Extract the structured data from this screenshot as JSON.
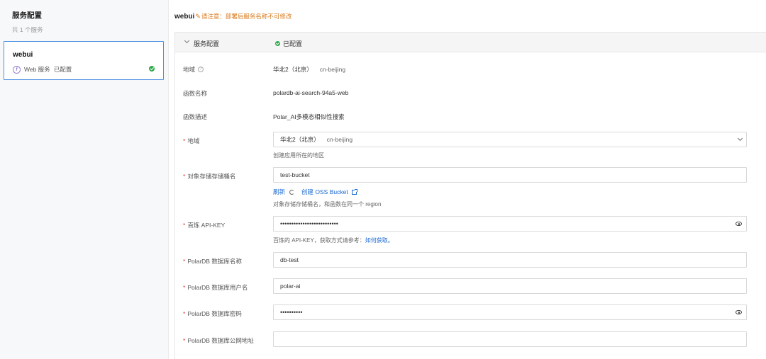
{
  "sidebar": {
    "title": "服务配置",
    "count": "共 1 个服务",
    "service": {
      "name": "webui",
      "type": "Web 服务",
      "status": "已配置"
    }
  },
  "header": {
    "service_name": "webui",
    "edit_icon": "pencil-icon",
    "warning": "请注意：部署后服务名称不可修改"
  },
  "panel": {
    "title": "服务配置",
    "status": "已配置"
  },
  "info": {
    "region_label": "地域",
    "region_value": "华北2（北京）",
    "region_code": "cn-beijing",
    "fn_name_label": "函数名称",
    "fn_name_value": "polardb-ai-search-94a5-web",
    "fn_desc_label": "函数描述",
    "fn_desc_value": "Polar_AI多模态相似性搜索"
  },
  "form": {
    "region": {
      "label": "地域",
      "value": "华北2（北京）",
      "code": "cn-beijing",
      "hint": "创建应用所在的地区"
    },
    "bucket": {
      "label": "对象存储存储桶名",
      "value": "test-bucket",
      "refresh": "刷新",
      "create": "创建 OSS Bucket",
      "hint": "对象存储存储桶名，和函数在同一个 region"
    },
    "apikey": {
      "label": "百炼 API-KEY",
      "value": "••••••••••••••••••••••••••",
      "hint": "百炼的 API-KEY，获取方式请参考：",
      "hint_link": "如何获取。"
    },
    "dbname": {
      "label": "PolarDB 数据库名称",
      "value": "db-test"
    },
    "dbuser": {
      "label": "PolarDB 数据库用户名",
      "value": "polar-ai"
    },
    "dbpass": {
      "label": "PolarDB 数据库密码",
      "value": "••••••••••"
    },
    "dbaddr": {
      "label": "PolarDB 数据库公网地址",
      "value": ""
    }
  }
}
